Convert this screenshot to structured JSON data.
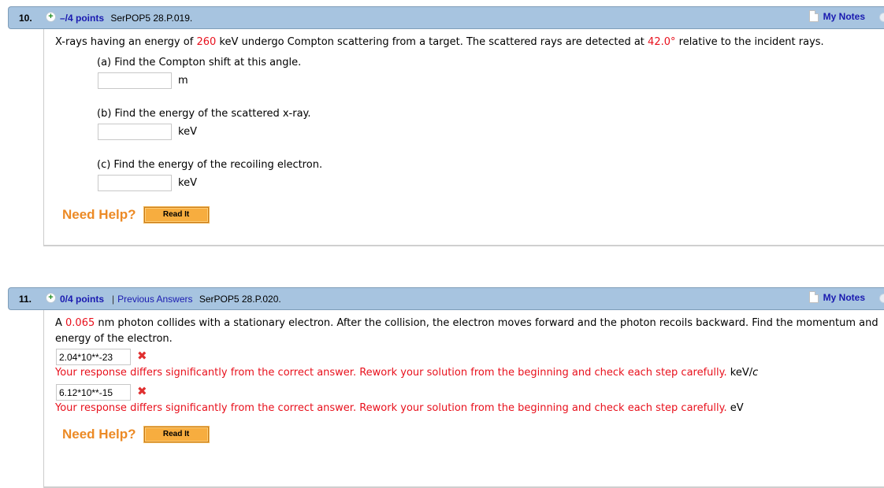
{
  "questions": [
    {
      "number": "10.",
      "points": "–/4 points",
      "reference": "SerPOP5 28.P.019.",
      "my_notes": "My Notes",
      "stem": {
        "t1": "X-rays having an energy of ",
        "v1": "260",
        "t2": " keV undergo Compton scattering from a target. The scattered rays are detected at ",
        "v2": "42.0°",
        "t3": " relative to the incident rays."
      },
      "parts": [
        {
          "label": "(a) Find the Compton shift at this angle.",
          "value": "",
          "unit": "m"
        },
        {
          "label": "(b) Find the energy of the scattered x-ray.",
          "value": "",
          "unit": "keV"
        },
        {
          "label": "(c) Find the energy of the recoiling electron.",
          "value": "",
          "unit": "keV"
        }
      ],
      "need_help": "Need Help?",
      "read_it": "Read It"
    },
    {
      "number": "11.",
      "points": "0/4 points",
      "separator": "|",
      "previous_answers": "Previous Answers",
      "reference": "SerPOP5 28.P.020.",
      "my_notes": "My Notes",
      "stem": {
        "t1": "A ",
        "v1": "0.065",
        "t2": " nm photon collides with a stationary electron. After the collision, the electron moves forward and the photon recoils backward. Find the momentum and",
        "line2": "energy of the electron."
      },
      "answers": [
        {
          "value": "2.04*10**-23",
          "status": "incorrect",
          "feedback": "Your response differs significantly from the correct answer. Rework your solution from the beginning and check each step carefully.",
          "unit_main": "keV/",
          "unit_italic": "c"
        },
        {
          "value": "6.12*10**-15",
          "status": "incorrect",
          "feedback": "Your response differs significantly from the correct answer. Rework your solution from the beginning and check each step carefully.",
          "unit_main": "eV",
          "unit_italic": ""
        }
      ],
      "need_help": "Need Help?",
      "read_it": "Read It"
    }
  ],
  "colors": {
    "header_bg": "#a7c4e0",
    "link_blue": "#1a1ab0",
    "value_red": "#e8101c",
    "help_orange": "#ec8a25",
    "button_orange": "#f7ad3f"
  }
}
